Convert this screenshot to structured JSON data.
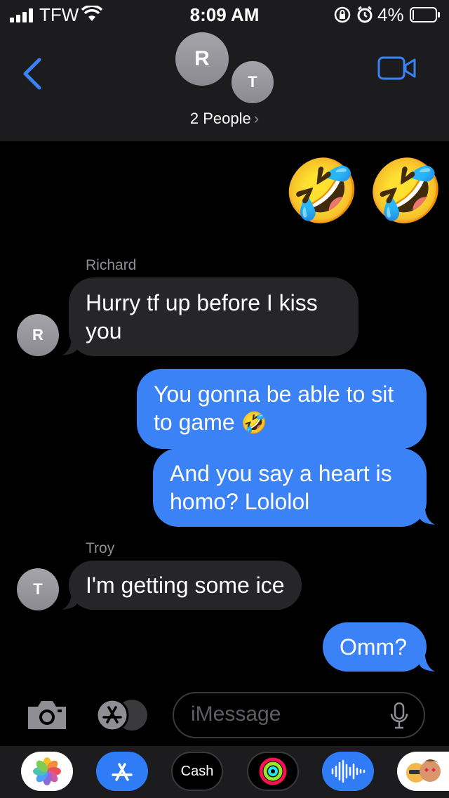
{
  "status_bar": {
    "carrier": "TFW",
    "time": "8:09 AM",
    "battery_percent": "4%",
    "battery_level": 0.04
  },
  "header": {
    "avatars": [
      {
        "initial": "R"
      },
      {
        "initial": "T"
      }
    ],
    "people_label": "2 People",
    "people_chevron": "›",
    "back_icon": "chevron-left-icon",
    "video_icon": "facetime-video-icon"
  },
  "messages": [
    {
      "direction": "out",
      "emoji": [
        "🤣",
        "🤣"
      ]
    },
    {
      "direction": "in",
      "sender": "Richard",
      "avatar": "R",
      "text": "Hurry tf up before I kiss you"
    },
    {
      "direction": "out",
      "text": "You gonna be able to sit to game",
      "trailing_emoji": "🤣"
    },
    {
      "direction": "out",
      "text": "And you say a heart is homo? Lololol"
    },
    {
      "direction": "in",
      "sender": "Troy",
      "avatar": "T",
      "text": "I'm getting some ice"
    },
    {
      "direction": "out",
      "text": "Omm?"
    }
  ],
  "composer": {
    "placeholder": "iMessage",
    "camera_icon": "camera-icon",
    "apps_icon": "app-store-icon",
    "mic_icon": "microphone-icon"
  },
  "app_drawer": {
    "apps": [
      {
        "name": "photos-app-icon"
      },
      {
        "name": "app-store-app-icon"
      },
      {
        "name": "apple-cash-app-icon",
        "label": "Cash"
      },
      {
        "name": "activity-app-icon"
      },
      {
        "name": "audio-message-app-icon"
      },
      {
        "name": "memoji-app-icon"
      }
    ]
  },
  "colors": {
    "outgoing_bubble": "#3a82f6",
    "incoming_bubble": "#262628",
    "accent": "#3a82f6",
    "header_bg": "#1c1c1e"
  }
}
